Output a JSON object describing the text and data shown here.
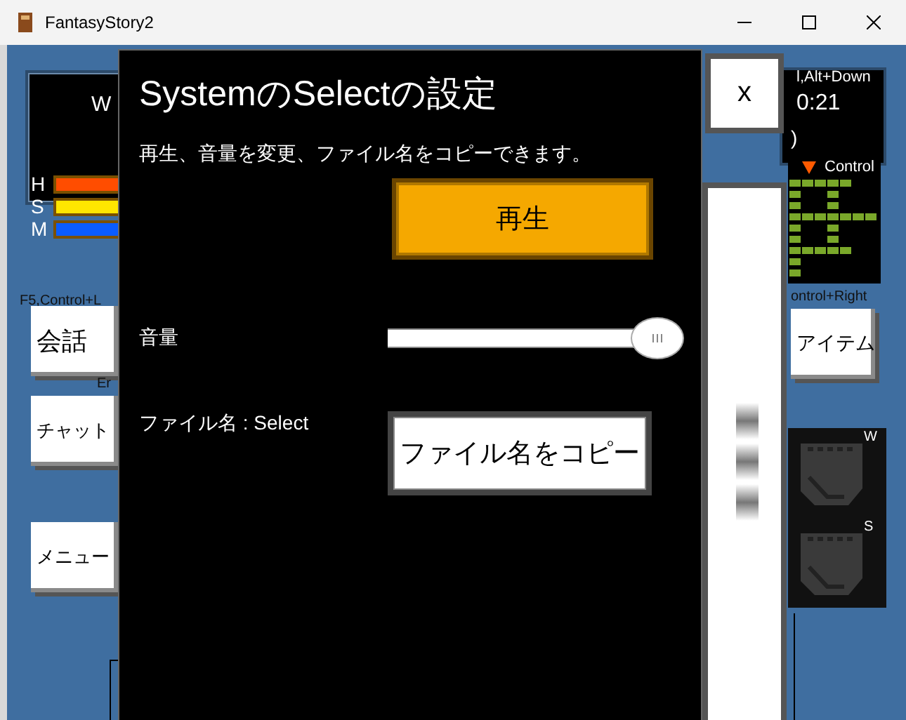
{
  "window": {
    "title": "FantasyStory2",
    "controls": [
      {
        "kind": "minimize"
      },
      {
        "kind": "maximize"
      },
      {
        "kind": "close"
      }
    ]
  },
  "hud": {
    "status_label": "W",
    "bars": [
      {
        "label": "H",
        "color": "#ff4d00"
      },
      {
        "label": "S",
        "color": "#ffe600"
      },
      {
        "label": "M",
        "color": "#0a5cff"
      }
    ],
    "left_hint": "F5,Control+L",
    "left_hint_2": "Er",
    "left_buttons": [
      {
        "label": "会話"
      },
      {
        "label": "チャット"
      },
      {
        "label": "メニュー"
      }
    ],
    "info_lines": [
      "l,Alt+Down",
      "0:21",
      ")"
    ],
    "map_label": "Control",
    "right_hint": "ontrol+Right",
    "right_button": "アイテム",
    "pad_labels": [
      "W",
      "S"
    ]
  },
  "dialog": {
    "title": "SystemのSelectの設定",
    "description": "再生、音量を変更、ファイル名をコピーできます。",
    "play_button": "再生",
    "volume_label": "音量",
    "volume": {
      "level": 0.93
    },
    "file_label": "ファイル名 : Select",
    "copy_button": "ファイル名をコピー",
    "close_button": "x"
  }
}
